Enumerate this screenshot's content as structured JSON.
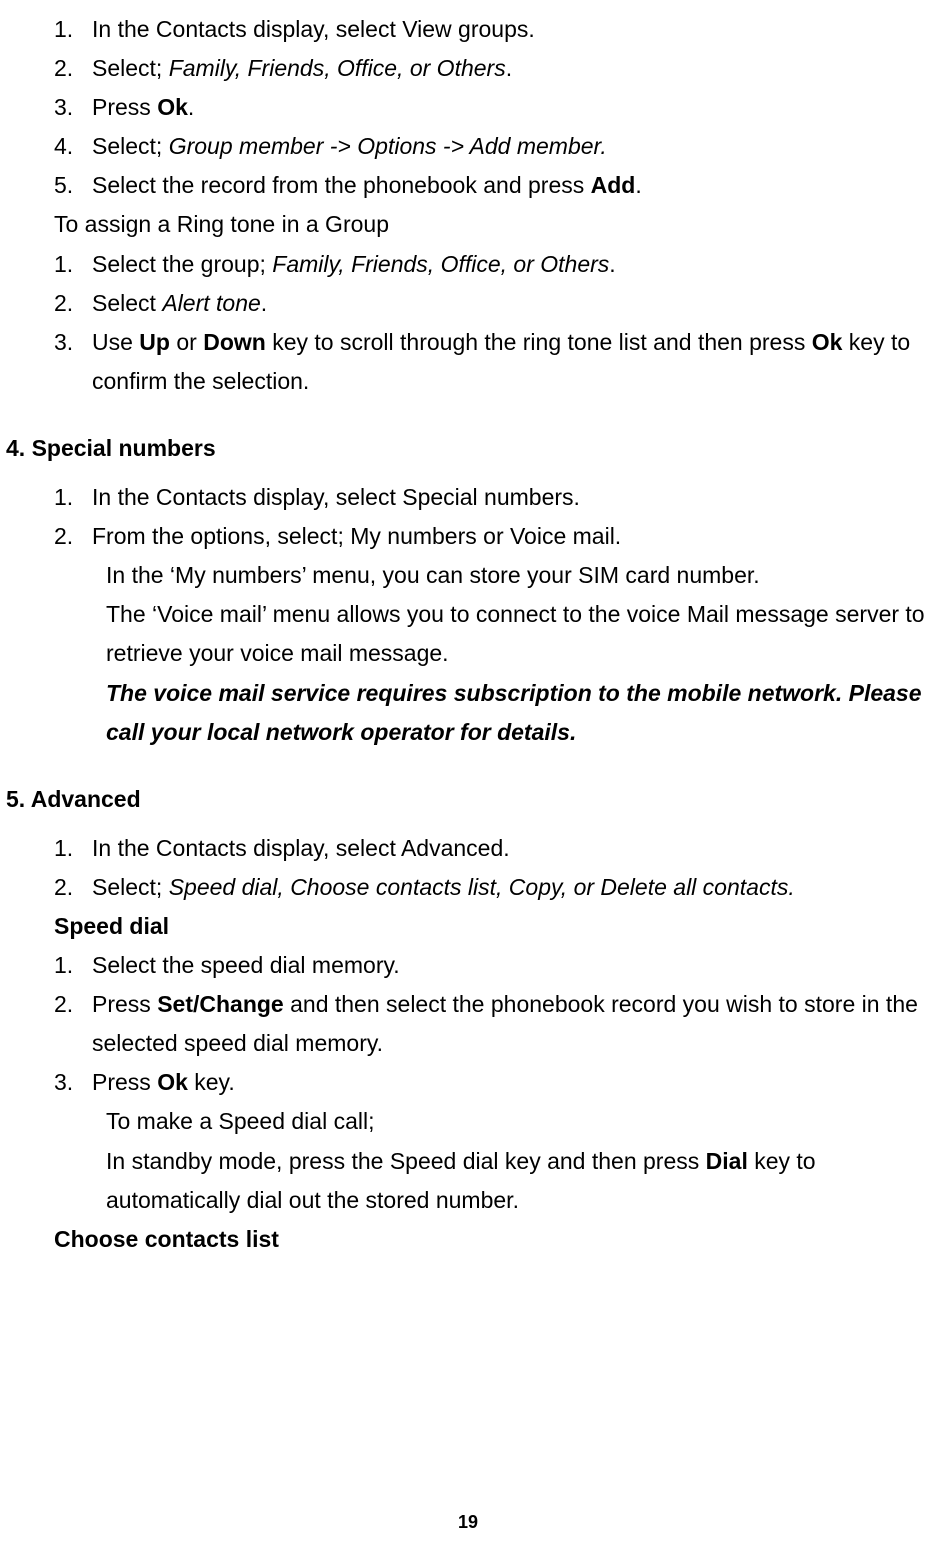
{
  "section_groups": {
    "l1": {
      "num": "1.",
      "t": "In the Contacts display, select View groups."
    },
    "l2": {
      "num": "2.",
      "t_pre": "Select; ",
      "t_ital": "Family, Friends, Office, or Others",
      "t_post": "."
    },
    "l3": {
      "num": "3.",
      "t_pre": "Press ",
      "t_bold": "Ok",
      "t_post": "."
    },
    "l4": {
      "num": "4.",
      "t_pre": "Select; ",
      "t_ital": "Group member -> Options -> Add member."
    },
    "l5": {
      "num": "5.",
      "t_pre": "Select the record from the phonebook and press ",
      "t_bold": "Add",
      "t_post": "."
    },
    "ring_title": "To assign a Ring tone in a Group",
    "r1": {
      "num": "1.",
      "t_pre": "Select the group; ",
      "t_ital": "Family, Friends, Office, or Others",
      "t_post": "."
    },
    "r2": {
      "num": "2.",
      "t_pre": "Select ",
      "t_ital": "Alert tone",
      "t_post": "."
    },
    "r3": {
      "num": "3.",
      "t_pre": "Use ",
      "t_bold1": "Up",
      "t_mid1": " or ",
      "t_bold2": "Down",
      "t_mid2": " key to scroll through the ring tone list and then press ",
      "t_bold3": "Ok",
      "t_post": " key to confirm the selection."
    }
  },
  "section4": {
    "heading": "4. Special numbers",
    "l1": {
      "num": "1.",
      "t": "In the Contacts display, select Special numbers."
    },
    "l2": {
      "num": "2.",
      "t": "From the options, select; My numbers or Voice mail."
    },
    "p1": "In the ‘My numbers’ menu, you can store your SIM card number.",
    "p2": "The ‘Voice mail’ menu allows you to connect to the voice Mail message server to retrieve your voice mail message.",
    "p3": "The voice mail service requires subscription to the mobile network. Please call your local network operator for details."
  },
  "section5": {
    "heading": "5. Advanced",
    "l1": {
      "num": "1.",
      "t": "In the Contacts display, select Advanced."
    },
    "l2": {
      "num": "2.",
      "t_pre": "Select; ",
      "t_ital": "Speed dial, Choose contacts list, Copy, or Delete all contacts."
    },
    "sub1": "Speed dial",
    "s1": {
      "num": "1.",
      "t": "Select the speed dial memory."
    },
    "s2": {
      "num": "2.",
      "t_pre": "Press ",
      "t_bold": "Set/Change",
      "t_post": " and then select the phonebook record you wish to store in the selected speed dial memory."
    },
    "s3": {
      "num": "3.",
      "t_pre": "Press ",
      "t_bold": "Ok",
      "t_post": " key."
    },
    "p1": "To make a Speed dial call;",
    "p2_pre": "In standby mode, press the Speed dial key and then press ",
    "p2_bold": "Dial",
    "p2_post": " key to automatically dial out the stored number.",
    "sub2": "Choose contacts list"
  },
  "page_number": "19"
}
